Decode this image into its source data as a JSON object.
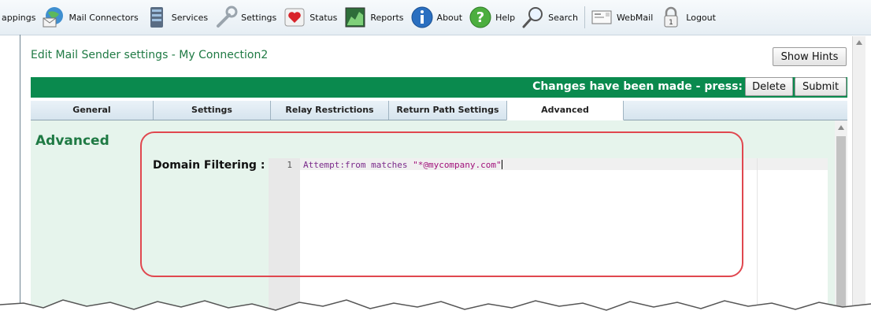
{
  "toolbar": {
    "items": [
      {
        "label": "appings",
        "icon": "partial-item"
      },
      {
        "label": "Mail Connectors",
        "icon": "globe-mail-icon"
      },
      {
        "label": "Services",
        "icon": "server-icon"
      },
      {
        "label": "Settings",
        "icon": "wrench-icon"
      },
      {
        "label": "Status",
        "icon": "heart-status-icon"
      },
      {
        "label": "Reports",
        "icon": "reports-icon"
      },
      {
        "label": "About",
        "icon": "info-icon"
      },
      {
        "label": "Help",
        "icon": "help-icon"
      },
      {
        "label": "Search",
        "icon": "search-icon"
      },
      {
        "label": "WebMail",
        "icon": "webmail-icon"
      },
      {
        "label": "Logout",
        "icon": "lock-icon"
      }
    ]
  },
  "page": {
    "title": "Edit Mail Sender settings - My Connection2",
    "show_hints_label": "Show Hints"
  },
  "header_bar": {
    "message": "Changes have been made - press:",
    "delete_label": "Delete",
    "submit_label": "Submit"
  },
  "tabs": [
    {
      "label": "General",
      "active": false
    },
    {
      "label": "Settings",
      "active": false
    },
    {
      "label": "Relay Restrictions",
      "active": false
    },
    {
      "label": "Return Path Settings",
      "active": false
    },
    {
      "label": "Advanced",
      "active": true
    }
  ],
  "section": {
    "title": "Advanced",
    "field_label": "Domain Filtering :"
  },
  "editor": {
    "line_number": "1",
    "code_prefix": "Attempt:from matches ",
    "code_string": "\"*@mycompany.com\""
  },
  "colors": {
    "green": "#0a8a4e",
    "title_green": "#1f7a44",
    "highlight": "#e0474f"
  }
}
